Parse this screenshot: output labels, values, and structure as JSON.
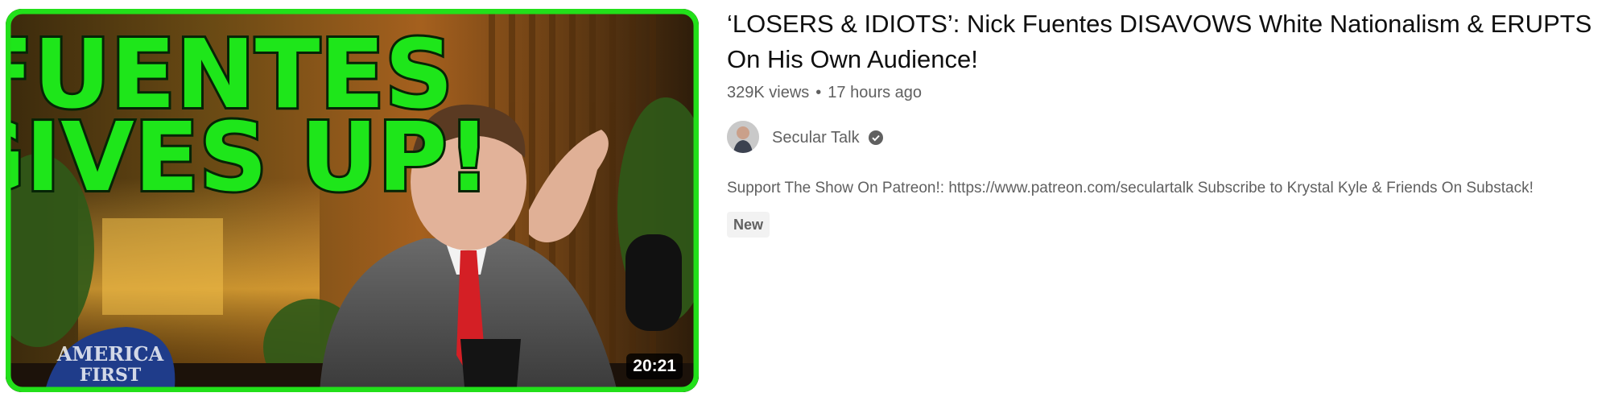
{
  "video": {
    "thumbnail": {
      "overlay_line1": "FUENTES",
      "overlay_line2": "GIVES UP!",
      "hat_text_line1": "AMERICA",
      "hat_text_line2": "FIRST",
      "border_color": "#22e01a",
      "duration": "20:21"
    },
    "title": "‘LOSERS & IDIOTS’: Nick Fuentes DISAVOWS White Nationalism & ERUPTS On His Own Audience!",
    "views": "329K views",
    "separator": "•",
    "age": "17 hours ago",
    "channel": {
      "name": "Secular Talk",
      "verified_icon": "verified-check-icon"
    },
    "description": "Support The Show On Patreon!: https://www.patreon.com/seculartalk Subscribe to Krystal Kyle & Friends On Substack!",
    "badge": "New"
  }
}
